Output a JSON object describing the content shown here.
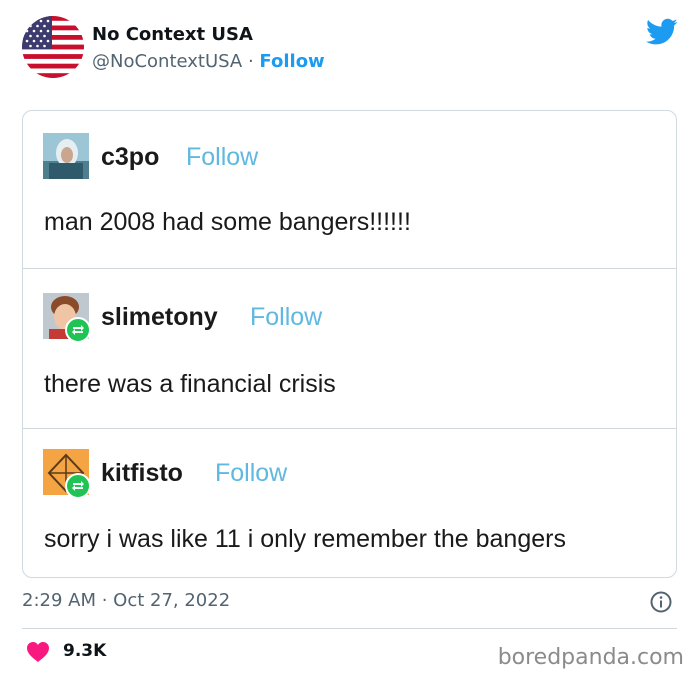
{
  "tweet": {
    "author_name": "No Context USA",
    "handle": "@NoContextUSA",
    "separator": " · ",
    "follow_label": "Follow",
    "timestamp": "2:29 AM · Oct 27, 2022",
    "likes": "9.3K"
  },
  "embed_posts": [
    {
      "username": "c3po",
      "follow_label": "Follow",
      "text": "man 2008 had some bangers!!!!!!",
      "avatar_icon": "c3po-avatar-icon"
    },
    {
      "username": "slimetony",
      "follow_label": "Follow",
      "text": "there was a financial crisis",
      "avatar_icon": "slimetony-avatar-icon"
    },
    {
      "username": "kitfisto",
      "follow_label": "Follow",
      "text": "sorry i was like 11 i only remember the bangers",
      "avatar_icon": "kitfisto-avatar-icon"
    }
  ],
  "watermark": "boredpanda.com",
  "colors": {
    "twitter_blue": "#1d9bf0",
    "tumblr_follow": "#5fb8e0",
    "reblog_green": "#1fc454",
    "heart": "#f91880"
  },
  "icons": [
    "us-flag-avatar-icon",
    "twitter-bird-icon",
    "reblog-icon",
    "info-icon",
    "heart-icon"
  ]
}
